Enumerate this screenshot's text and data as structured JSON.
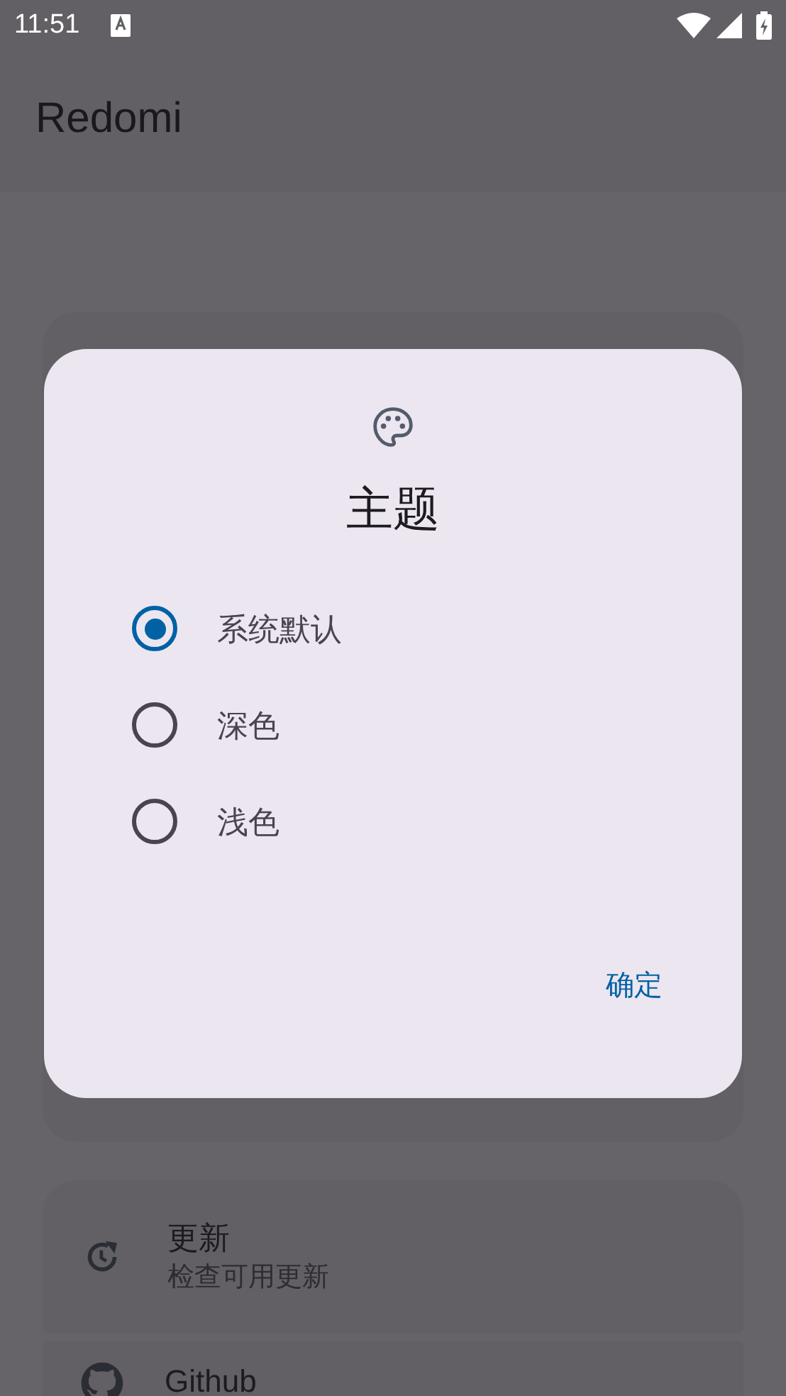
{
  "status_bar": {
    "time": "11:51"
  },
  "app_bar": {
    "title": "Redomi"
  },
  "settings": [
    {
      "kind": "update",
      "title": "更新",
      "subtitle": "检查可用更新"
    },
    {
      "kind": "github",
      "title": "Github"
    }
  ],
  "dialog": {
    "title": "主题",
    "options": [
      {
        "label": "系统默认",
        "selected": true
      },
      {
        "label": "深色",
        "selected": false
      },
      {
        "label": "浅色",
        "selected": false
      }
    ],
    "confirm": "确定"
  }
}
